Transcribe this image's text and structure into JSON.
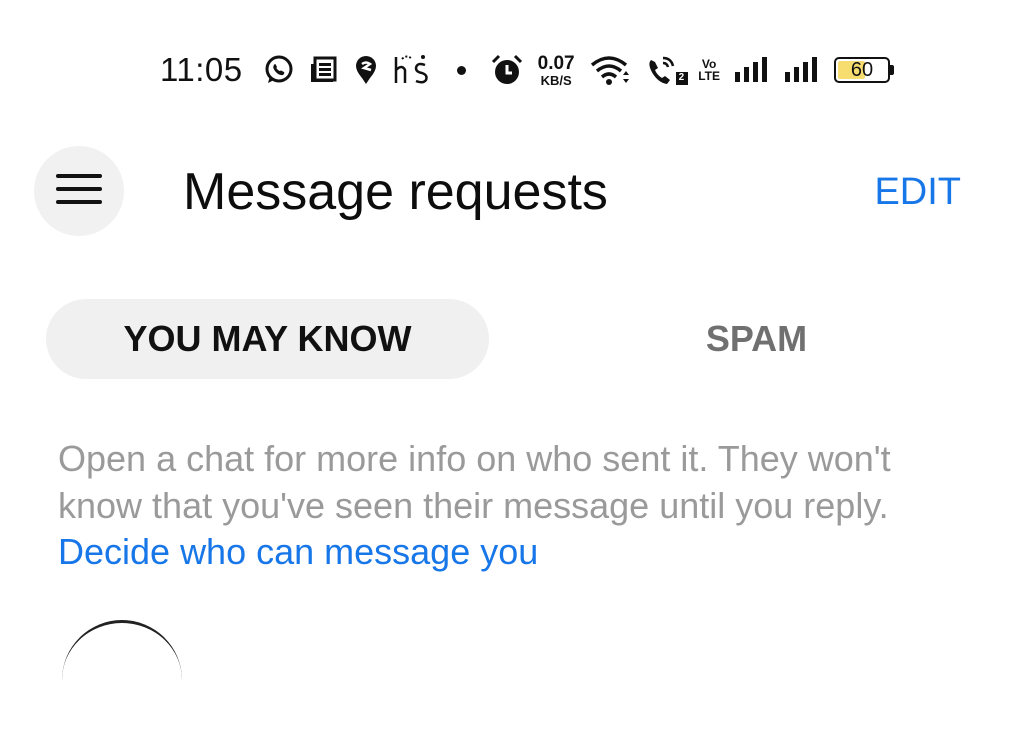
{
  "status_bar": {
    "time": "11:05",
    "net_speed_value": "0.07",
    "net_speed_unit": "KB/S",
    "volte_top": "Vo",
    "volte_bottom": "LTE",
    "sim2_label": "2",
    "battery_level": "60",
    "battery_fill_color": "#f7dc6f",
    "icons": [
      "whatsapp-icon",
      "news-icon",
      "swiggy-icon",
      "notification-icon",
      "alarm-icon",
      "wifi-icon",
      "wifi-calling-icon",
      "signal-icon"
    ]
  },
  "header": {
    "title": "Message requests",
    "edit_label": "EDIT",
    "menu_icon": "hamburger-menu-icon"
  },
  "tabs": [
    {
      "label": "YOU MAY KNOW",
      "selected": true
    },
    {
      "label": "SPAM",
      "selected": false
    }
  ],
  "info": {
    "text": "Open a chat for more info on who sent it. They won't know that you've seen their message until you reply.",
    "link_text": "Decide who can message you"
  },
  "colors": {
    "accent": "#1877e8",
    "muted_text": "#9a9a9a",
    "tab_bg": "#f0f0f0",
    "spam_text": "#707070"
  }
}
